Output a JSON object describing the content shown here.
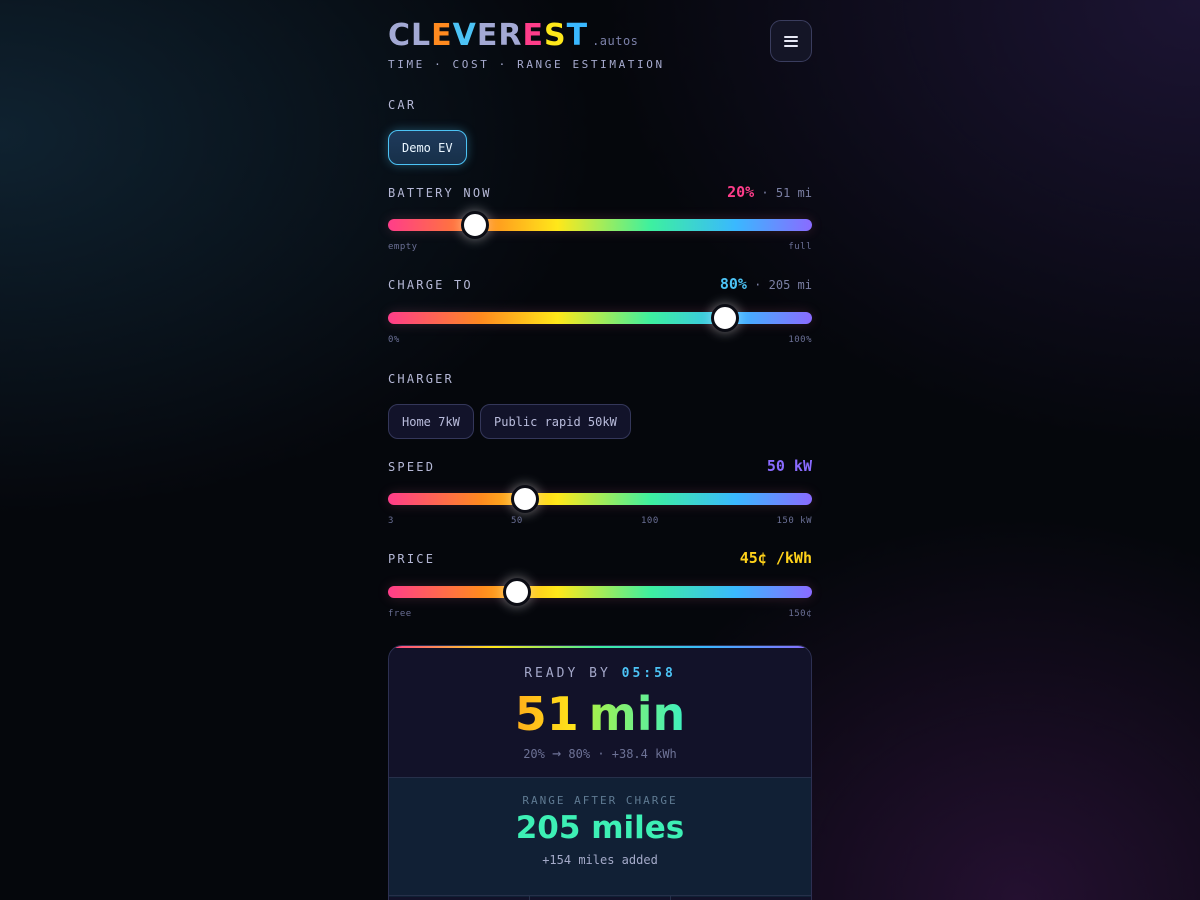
{
  "header": {
    "logo_letters": [
      "C",
      "L",
      "E",
      "V",
      "E",
      "R",
      "E",
      "S",
      "T"
    ],
    "logo_colors": [
      "#a3a9d4",
      "#a3a9d4",
      "#ff8a1f",
      "#4cc3f5",
      "#a3a9d4",
      "#a3a9d4",
      "#ff3d8a",
      "#ffe81a",
      "#3ab8ff"
    ],
    "logo_suffix": ".autos",
    "tagline": "TIME · COST · RANGE ESTIMATION",
    "menu_icon": "hamburger-menu-icon"
  },
  "car": {
    "label": "CAR",
    "options": [
      "Demo EV"
    ],
    "selected": "Demo EV"
  },
  "battery": {
    "label": "BATTERY NOW",
    "percent_text": "20%",
    "separator": "·",
    "miles_text": "51 mi",
    "value_percent": 20,
    "min_label": "empty",
    "max_label": "full",
    "accent": "#ff3d8a"
  },
  "charge_to": {
    "label": "CHARGE TO",
    "percent_text": "80%",
    "separator": "·",
    "miles_text": "205 mi",
    "value_percent": 80,
    "min_label": "0%",
    "max_label": "100%",
    "accent": "#4cc3f5"
  },
  "charger": {
    "label": "CHARGER",
    "options": [
      "Home 7kW",
      "Public rapid 50kW"
    ]
  },
  "speed": {
    "label": "SPEED",
    "value_text": "50 kW",
    "value_kw": 50,
    "ticks": [
      "3",
      "50",
      "100",
      "150 kW"
    ],
    "accent": "#8a6bff"
  },
  "price": {
    "label": "PRICE",
    "value_text": "45¢ /kWh",
    "value_cents": 45,
    "min_label": "free",
    "max_label": "150¢",
    "accent": "#ffd21a"
  },
  "result": {
    "ready_label": "READY BY",
    "ready_time": "05:58",
    "duration_number": "51",
    "duration_unit": "min",
    "from_pct": "20%",
    "arrow": "→",
    "to_pct": "80%",
    "energy_added": "· +38.4 kWh",
    "range_label": "RANGE AFTER CHARGE",
    "range_value": "205 miles",
    "range_added": "+154 miles added"
  }
}
